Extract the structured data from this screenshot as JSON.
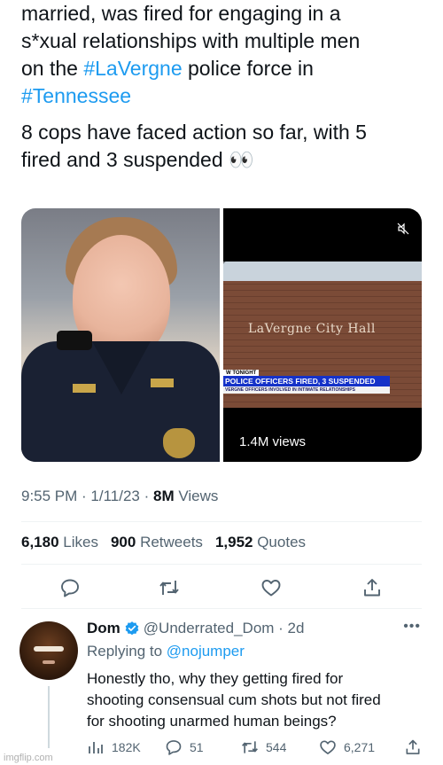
{
  "tweet": {
    "text_lines": [
      "married, was fired for engaging in a",
      "s*xual relationships with multiple men",
      "on the ",
      "#LaVergne",
      " police force in",
      "#Tennessee"
    ],
    "para2_lines": [
      "8 cops have faced action so far, with 5",
      "fired and 3 suspended 👀"
    ],
    "video": {
      "sign_text": "LaVergne City Hall",
      "tonight": "W TONIGHT",
      "headline": "POLICE OFFICERS FIRED, 3 SUSPENDED",
      "subline": "VERGNE OFFICERS INVOLVED IN INTIMATE RELATIONSHIPS",
      "views": "1.4M views",
      "mute_icon": "mute-icon"
    },
    "meta": {
      "time": "9:55 PM · 1/11/23 · ",
      "views_count": "8M",
      "views_label": " Views"
    },
    "stats": {
      "likes_count": "6,180",
      "likes_label": " Likes",
      "retweets_count": "900",
      "retweets_label": " Retweets",
      "quotes_count": "1,952",
      "quotes_label": " Quotes"
    },
    "actions": [
      "reply-icon",
      "retweet-icon",
      "like-icon",
      "share-icon"
    ]
  },
  "reply": {
    "name": "Dom",
    "handle_time": "@Underrated_Dom · 2d",
    "replying_prefix": "Replying to ",
    "replying_handle": "@nojumper",
    "text_lines": [
      "Honestly tho, why they getting fired for",
      "shooting consensual cum shots but not fired",
      "for shooting unarmed human beings?"
    ],
    "more": "•••",
    "counts": {
      "views": "182K",
      "replies": "51",
      "retweets": "544",
      "likes": "6,271"
    }
  },
  "watermark": "imgflip.com",
  "colors": {
    "link": "#1d9bf0",
    "text": "#0f1419",
    "muted": "#536471",
    "headline_bar": "#1532c8"
  }
}
